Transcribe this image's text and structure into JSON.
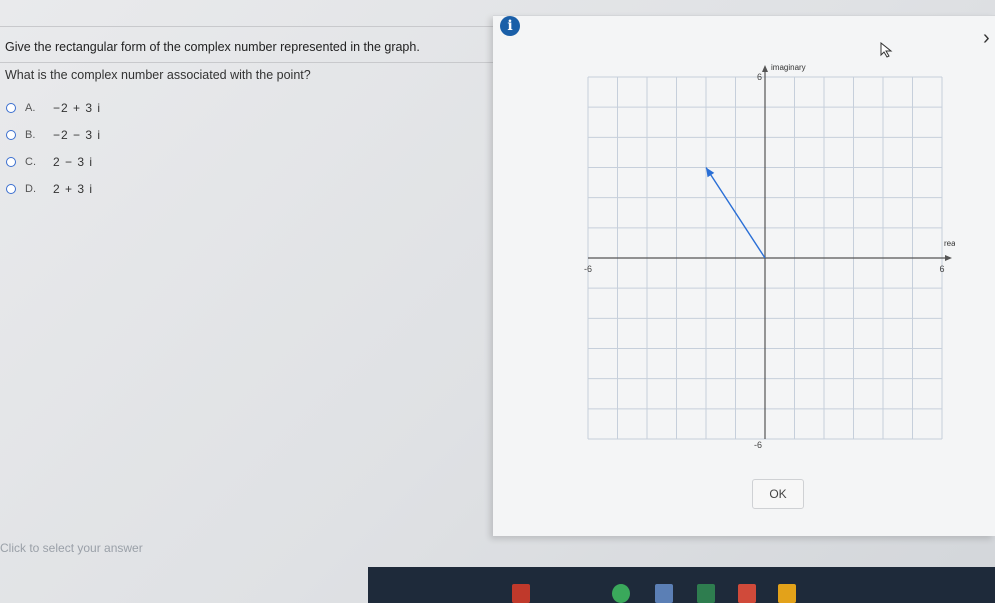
{
  "question": "Give the rectangular form of the complex number represented in the graph.",
  "prompt": "What is the complex number associated with the point?",
  "choices": [
    {
      "letter": "A.",
      "text": "−2 + 3 i"
    },
    {
      "letter": "B.",
      "text": "−2 − 3 i"
    },
    {
      "letter": "C.",
      "text": "2 − 3 i"
    },
    {
      "letter": "D.",
      "text": "2 + 3 i"
    }
  ],
  "select_hint": "Click to select your answer",
  "dialog": {
    "ok_label": "OK",
    "info_glyph": "i",
    "close_glyph": "›",
    "graph": {
      "x_label": "real",
      "y_label": "imaginary",
      "x_min_label": "-6",
      "x_max_label": "6",
      "y_min_label": "-6",
      "y_max_label": "6",
      "range": [
        -6,
        6
      ],
      "point": {
        "x": -2,
        "y": 3
      },
      "vector_color": "#2a6fd6",
      "grid_color": "#c6cfdb"
    }
  },
  "icons": [
    "info-icon",
    "close-icon",
    "cursor-icon"
  ]
}
